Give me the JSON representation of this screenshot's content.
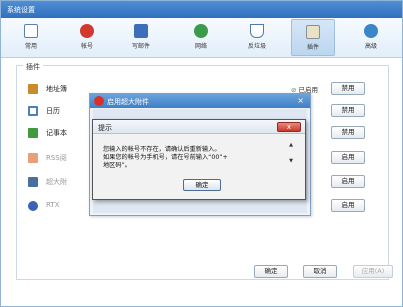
{
  "window": {
    "title": "系统设置"
  },
  "toolbar": {
    "items": [
      {
        "label": "常用",
        "icon": "common-icon",
        "color": "#5b7fb0"
      },
      {
        "label": "帐号",
        "icon": "account-icon",
        "color": "#d23a2f"
      },
      {
        "label": "写邮件",
        "icon": "compose-icon",
        "color": "#3d6fb8"
      },
      {
        "label": "网络",
        "icon": "network-icon",
        "color": "#3b9b4a"
      },
      {
        "label": "反垃圾",
        "icon": "antispam-icon",
        "color": "#4f79b0"
      },
      {
        "label": "插件",
        "icon": "plugin-icon",
        "color": "#8a8f96"
      },
      {
        "label": "高级",
        "icon": "advanced-icon",
        "color": "#3a86c9"
      }
    ],
    "active_index": 5
  },
  "plugins": {
    "title": "插件",
    "items": [
      {
        "label": "地址簿",
        "status": "已启用",
        "button": "禁用",
        "icon": "address-book-icon",
        "color": "#c98a2c"
      },
      {
        "label": "日历",
        "status": "",
        "button": "禁用",
        "icon": "calendar-icon",
        "color": "#4a7fbf"
      },
      {
        "label": "记事本",
        "status": "",
        "button": "禁用",
        "icon": "notepad-icon",
        "color": "#3f9b3c"
      },
      {
        "label": "RSS阅",
        "status": "",
        "button": "启用",
        "icon": "rss-icon",
        "color": "#e7a07a"
      },
      {
        "label": "超大附",
        "status": "",
        "button": "启用",
        "icon": "attachment-icon",
        "color": "#4a6f9f"
      },
      {
        "label": "RTX",
        "status": "",
        "button": "启用",
        "icon": "rtx-icon",
        "color": "#3a62b5"
      }
    ]
  },
  "inner_dialog": {
    "title": "启用超大附件",
    "close": "×"
  },
  "alert": {
    "title": "提示",
    "close": "x",
    "message_lines": [
      "您输入的帐号不存在，请确认后重新输入。",
      "如果您的帐号为手机号，请在号前输入“00”+",
      "地区码”。"
    ],
    "ok": "确定"
  },
  "footer": {
    "ok": "确定",
    "cancel": "取消",
    "apply": "应用(A)"
  }
}
